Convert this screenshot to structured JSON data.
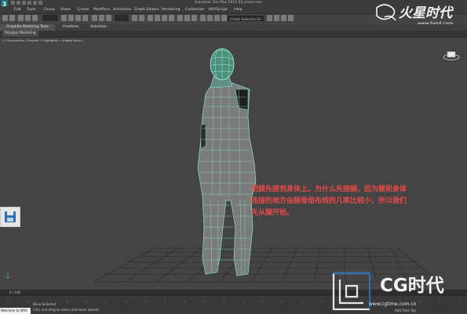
{
  "window": {
    "app_logo": "3",
    "title": "Autodesk 3ds Max 2010    03_head.max"
  },
  "menu": {
    "items": [
      "Edit",
      "Tools",
      "Group",
      "Views",
      "Create",
      "Modifiers",
      "Animation",
      "Graph Editors",
      "Rendering",
      "Customize",
      "MAXScript",
      "Help"
    ]
  },
  "toolbar": {
    "selection_set_placeholder": "Create Selection Se"
  },
  "ribbon": {
    "tabs": [
      "Graphite Modeling Tools",
      "Freeform",
      "Selection"
    ],
    "panel_label": "Polygon Modeling"
  },
  "viewport": {
    "label": "+ [ Perspective ] Smooth + Highlights + Edged Faces ]"
  },
  "annotation": {
    "lines": [
      "把腿先接到身体上。为什么先接腿，因为腿和身体",
      "连接的地方由腿骨组布线的几率比较小，所以我们",
      "先从腿开始。"
    ]
  },
  "timeline": {
    "frame_label": "0 / 100"
  },
  "status": {
    "welcome": "Welcome to MAX",
    "line1": "None Selected",
    "line2": "Click and drag to select and move objects",
    "add_time_tag": "Add Time Tag"
  },
  "watermarks": {
    "top_site": "www.hxsd.com",
    "cg_text": "CG时代",
    "cg_url": "www.cgtime.com.cn"
  },
  "colors": {
    "viewport_bg": "#444444",
    "mesh_wire": "#6fd3b8",
    "annotation": "#e94a4a"
  }
}
